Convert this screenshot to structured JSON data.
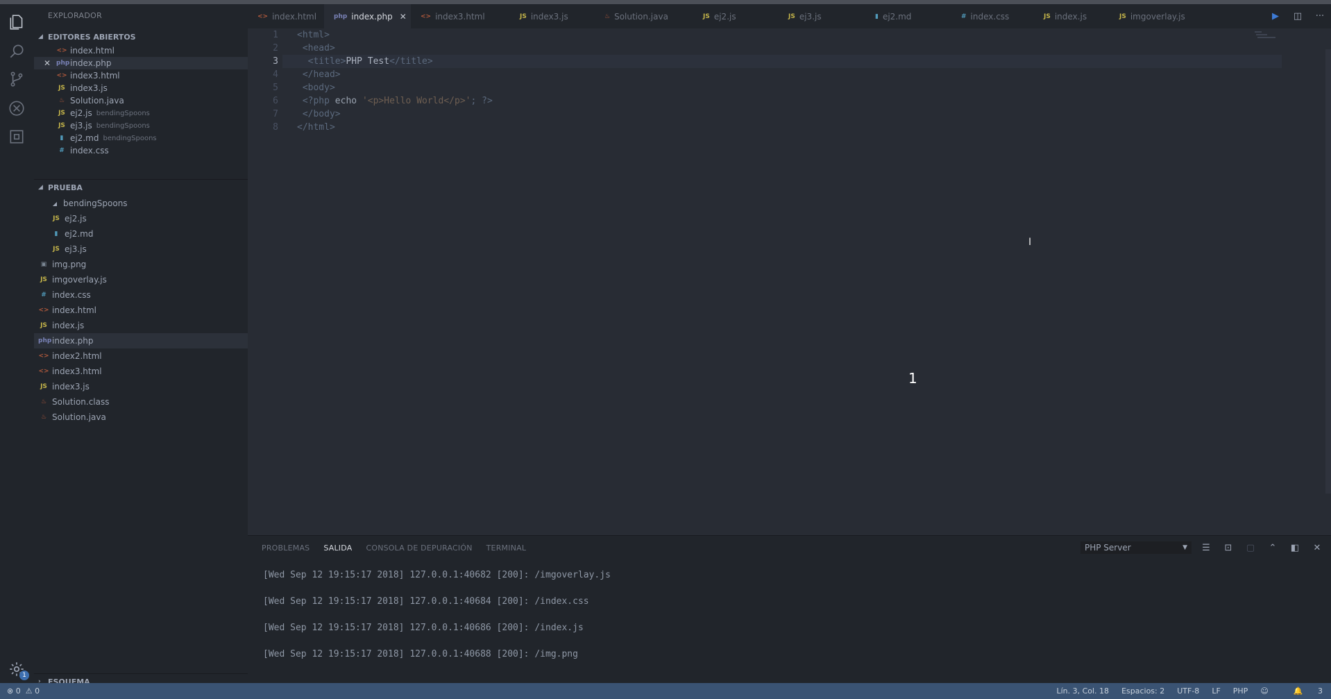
{
  "sidebar": {
    "title": "EXPLORADOR",
    "open_editors_label": "EDITORES ABIERTOS",
    "open_editors": [
      {
        "name": "index.html",
        "type": "html"
      },
      {
        "name": "index.php",
        "type": "php",
        "active": true
      },
      {
        "name": "index3.html",
        "type": "html"
      },
      {
        "name": "index3.js",
        "type": "js"
      },
      {
        "name": "Solution.java",
        "type": "java"
      },
      {
        "name": "ej2.js",
        "type": "js",
        "desc": "bendingSpoons"
      },
      {
        "name": "ej3.js",
        "type": "js",
        "desc": "bendingSpoons"
      },
      {
        "name": "ej2.md",
        "type": "md",
        "desc": "bendingSpoons"
      },
      {
        "name": "index.css",
        "type": "css"
      }
    ],
    "project_label": "PRUEBA",
    "folder": "bendingSpoons",
    "folder_files": [
      {
        "name": "ej2.js",
        "type": "js"
      },
      {
        "name": "ej2.md",
        "type": "md"
      },
      {
        "name": "ej3.js",
        "type": "js"
      }
    ],
    "files": [
      {
        "name": "img.png",
        "type": "img"
      },
      {
        "name": "imgoverlay.js",
        "type": "js"
      },
      {
        "name": "index.css",
        "type": "css"
      },
      {
        "name": "index.html",
        "type": "html"
      },
      {
        "name": "index.js",
        "type": "js"
      },
      {
        "name": "index.php",
        "type": "php",
        "active": true
      },
      {
        "name": "index2.html",
        "type": "html"
      },
      {
        "name": "index3.html",
        "type": "html"
      },
      {
        "name": "index3.js",
        "type": "js"
      },
      {
        "name": "Solution.class",
        "type": "java"
      },
      {
        "name": "Solution.java",
        "type": "java"
      }
    ],
    "outline_label": "ESQUEMA"
  },
  "tabs": [
    {
      "name": "index.html",
      "type": "html"
    },
    {
      "name": "index.php",
      "type": "php",
      "active": true
    },
    {
      "name": "index3.html",
      "type": "html"
    },
    {
      "name": "index3.js",
      "type": "js"
    },
    {
      "name": "Solution.java",
      "type": "java"
    },
    {
      "name": "ej2.js",
      "type": "js"
    },
    {
      "name": "ej3.js",
      "type": "js"
    },
    {
      "name": "ej2.md",
      "type": "md"
    },
    {
      "name": "index.css",
      "type": "css"
    },
    {
      "name": "index.js",
      "type": "js"
    },
    {
      "name": "imgoverlay.js",
      "type": "js"
    }
  ],
  "editor": {
    "current_line": 3,
    "lines": [
      {
        "n": "1",
        "html": "<span class='t-tag'>&lt;html&gt;</span>"
      },
      {
        "n": "2",
        "html": " <span class='t-tag'>&lt;head&gt;</span>"
      },
      {
        "n": "3",
        "html": "  <span class='t-tag'>&lt;title&gt;</span><span class='t-txt'>PHP Test</span><span class='t-tag'>&lt;/title&gt;</span>"
      },
      {
        "n": "4",
        "html": " <span class='t-tag'>&lt;/head&gt;</span>"
      },
      {
        "n": "5",
        "html": " <span class='t-tag'>&lt;body&gt;</span>"
      },
      {
        "n": "6",
        "html": " <span class='t-kw'>&lt;?php</span> <span class='t-echo'>echo</span> <span class='t-str'>'&lt;p&gt;Hello World&lt;/p&gt;'</span><span class='t-kw'>; ?&gt;</span>"
      },
      {
        "n": "7",
        "html": " <span class='t-tag'>&lt;/body&gt;</span>"
      },
      {
        "n": "8",
        "html": "<span class='t-tag'>&lt;/html&gt;</span>"
      }
    ],
    "overlay_number": "1"
  },
  "panel": {
    "tabs": [
      {
        "label": "PROBLEMAS"
      },
      {
        "label": "SALIDA",
        "active": true
      },
      {
        "label": "CONSOLA DE DEPURACIÓN"
      },
      {
        "label": "TERMINAL"
      }
    ],
    "selected_output": "PHP Server",
    "output_lines": [
      "[Wed Sep 12 19:15:17 2018] 127.0.0.1:40682 [200]: /imgoverlay.js",
      "[Wed Sep 12 19:15:17 2018] 127.0.0.1:40684 [200]: /index.css",
      "[Wed Sep 12 19:15:17 2018] 127.0.0.1:40686 [200]: /index.js",
      "[Wed Sep 12 19:15:17 2018] 127.0.0.1:40688 [200]: /img.png"
    ]
  },
  "status": {
    "errors": "0",
    "warnings": "0",
    "position": "Lín. 3, Col. 18",
    "spaces": "Espacios: 2",
    "encoding": "UTF-8",
    "eol": "LF",
    "language": "PHP",
    "notifications": "3"
  },
  "settings_badge": "1",
  "colors": {
    "html": "#b0593c",
    "php": "#7a83b8",
    "js": "#c5b54a",
    "java": "#b0593c",
    "md": "#519aba",
    "css": "#519aba",
    "img": "#7b8794"
  }
}
